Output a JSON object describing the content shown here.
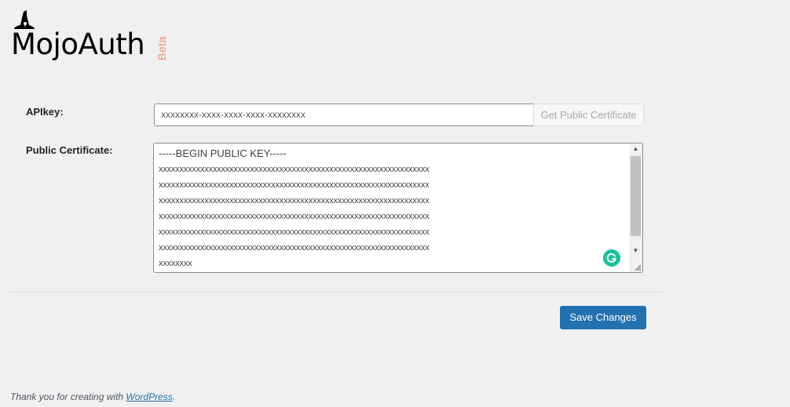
{
  "logo": {
    "name": "MojoAuth",
    "badge": "Beta",
    "badge_color": "#f0906f",
    "icon": "wizard-hat-icon"
  },
  "form": {
    "apikey_label": "APIkey:",
    "apikey_value": "xxxxxxxx-xxxx-xxxx-xxxx-xxxxxxxx",
    "get_cert_label": "Get Public Certificate",
    "cert_label": "Public Certificate:",
    "cert_lines": [
      "-----BEGIN PUBLIC KEY-----",
      "xxxxxxxxxxxxxxxxxxxxxxxxxxxxxxxxxxxxxxxxxxxxxxxxxxxxxxxxxxxxxxxxx",
      "xxxxxxxxxxxxxxxxxxxxxxxxxxxxxxxxxxxxxxxxxxxxxxxxxxxxxxxxxxxxxxxxx",
      "xxxxxxxxxxxxxxxxxxxxxxxxxxxxxxxxxxxxxxxxxxxxxxxxxxxxxxxxxxxxxxxxx",
      "xxxxxxxxxxxxxxxxxxxxxxxxxxxxxxxxxxxxxxxxxxxxxxxxxxxxxxxxxxxxxxxxx",
      "xxxxxxxxxxxxxxxxxxxxxxxxxxxxxxxxxxxxxxxxxxxxxxxxxxxxxxxxxxxxxxxxx",
      "xxxxxxxxxxxxxxxxxxxxxxxxxxxxxxxxxxxxxxxxxxxxxxxxxxxxxxxxxxxxxxxxx",
      "xxxxxxxx"
    ],
    "save_label": "Save Changes"
  },
  "footer": {
    "text": "Thank you for creating with ",
    "link": "WordPress",
    "suffix": "."
  },
  "colors": {
    "accent": "#2271b1",
    "grammarly": "#15c39a",
    "background": "#f0f0f1"
  }
}
